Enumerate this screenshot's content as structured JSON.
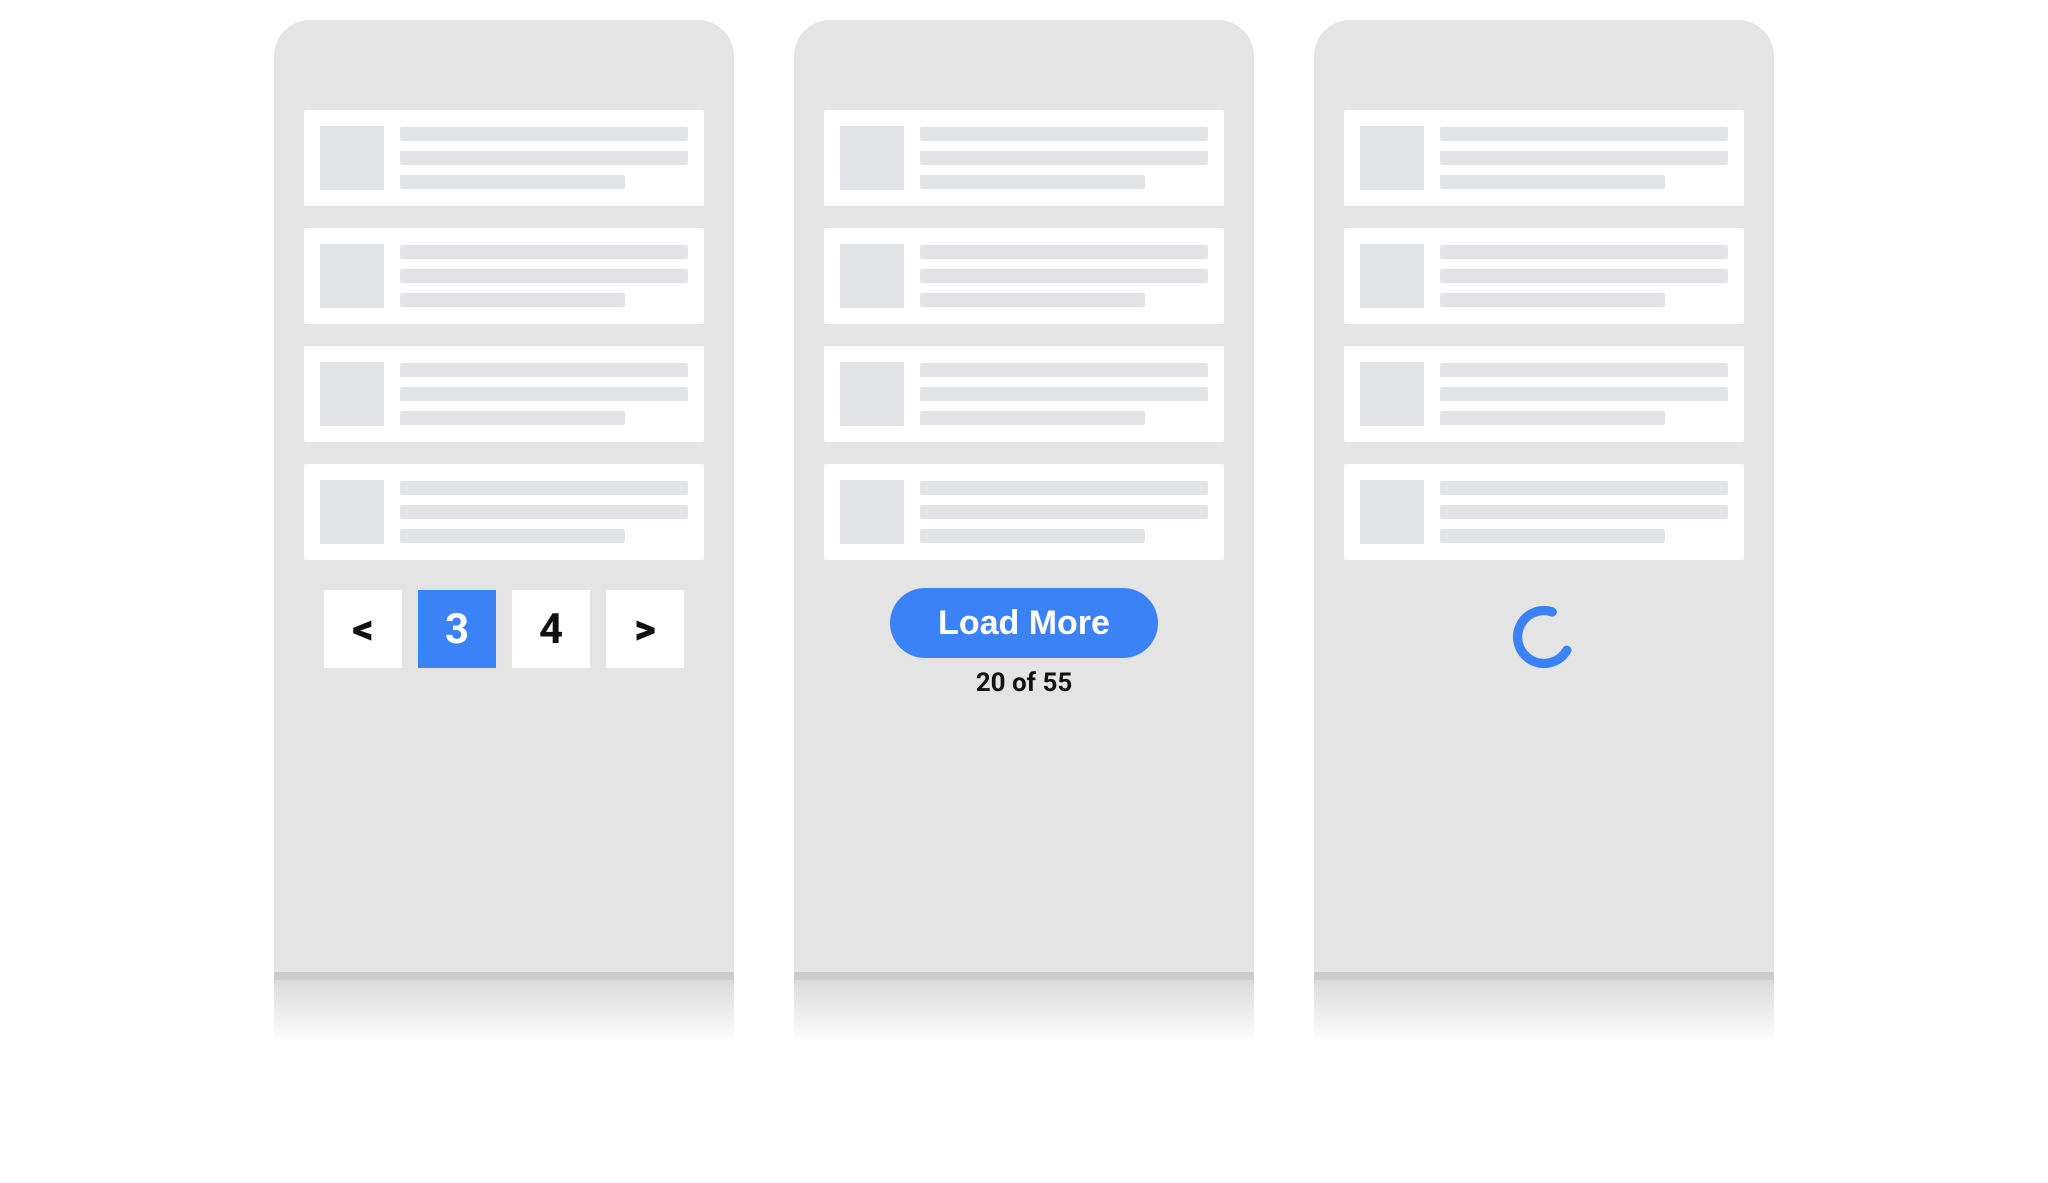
{
  "accent_color": "#3b82f6",
  "phones": {
    "pagination": {
      "list_item_count": 4,
      "pager": {
        "prev_label": "<",
        "next_label": ">",
        "pages": [
          {
            "label": "3",
            "active": true
          },
          {
            "label": "4",
            "active": false
          }
        ]
      }
    },
    "load_more": {
      "list_item_count": 4,
      "button_label": "Load More",
      "count_text": "20 of 55"
    },
    "infinite_scroll": {
      "list_item_count": 4,
      "spinner": true
    }
  }
}
